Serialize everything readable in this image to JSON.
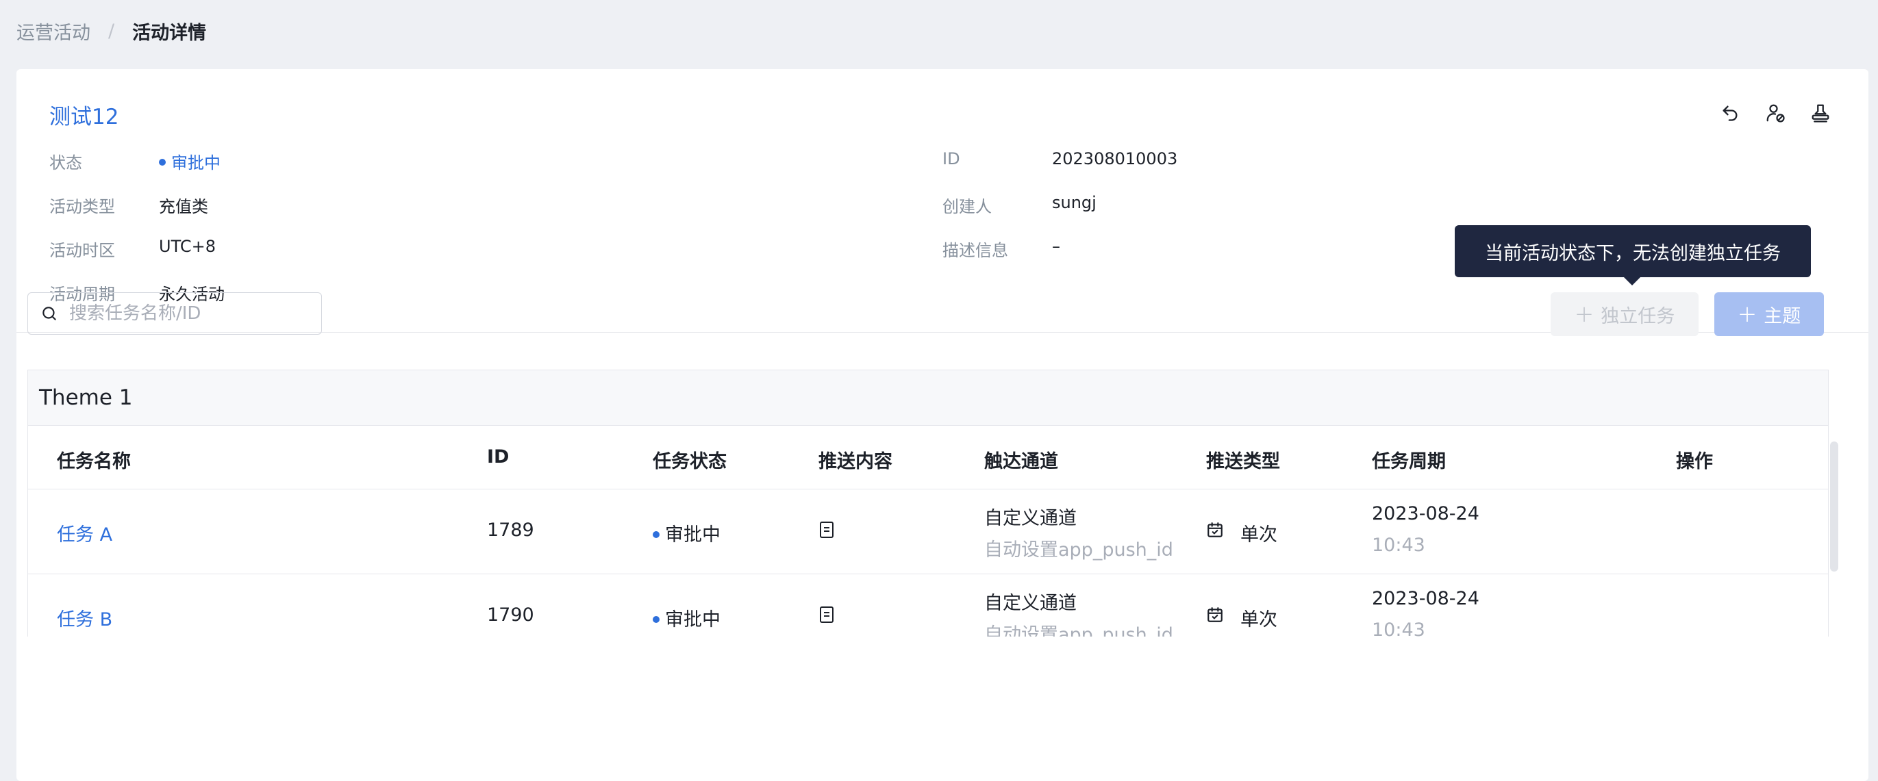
{
  "breadcrumb": {
    "parent": "运营活动",
    "separator": "/",
    "current": "活动详情"
  },
  "activity": {
    "title": "测试12",
    "left_fields": [
      {
        "label": "状态",
        "value": "审批中"
      },
      {
        "label": "活动类型",
        "value": "充值类"
      },
      {
        "label": "活动时区",
        "value": "UTC+8"
      },
      {
        "label": "活动周期",
        "value": "永久活动"
      }
    ],
    "right_fields": [
      {
        "label": "ID",
        "value": "202308010003"
      },
      {
        "label": "创建人",
        "value": "sungj"
      },
      {
        "label": "描述信息",
        "value": "–"
      }
    ]
  },
  "header_icons": [
    "undo-icon",
    "user-block-icon",
    "stamp-icon"
  ],
  "toolbar": {
    "search_placeholder": "搜索任务名称/ID",
    "independent_task_label": "独立任务",
    "theme_label": "主题",
    "tooltip": "当前活动状态下，无法创建独立任务"
  },
  "colors": {
    "accent": "#2e6fdc",
    "tooltip_bg": "#1f2740",
    "arrow": "#e5492d"
  },
  "table": {
    "theme_name": "Theme 1",
    "columns": [
      "任务名称",
      "ID",
      "任务状态",
      "推送内容",
      "触达通道",
      "推送类型",
      "任务周期",
      "操作"
    ],
    "rows": [
      {
        "name": "任务 A",
        "id": "1789",
        "status": "审批中",
        "content_icon": "document-icon",
        "channel": "自定义通道",
        "channel_sub": "自动设置app_push_id",
        "push_type": "单次",
        "date": "2023-08-24",
        "time": "10:43"
      },
      {
        "name": "任务 B",
        "id": "1790",
        "status": "审批中",
        "content_icon": "document-icon",
        "channel": "自定义通道",
        "channel_sub": "自动设置app_push_id",
        "push_type": "单次",
        "date": "2023-08-24",
        "time": "10:43"
      }
    ]
  }
}
